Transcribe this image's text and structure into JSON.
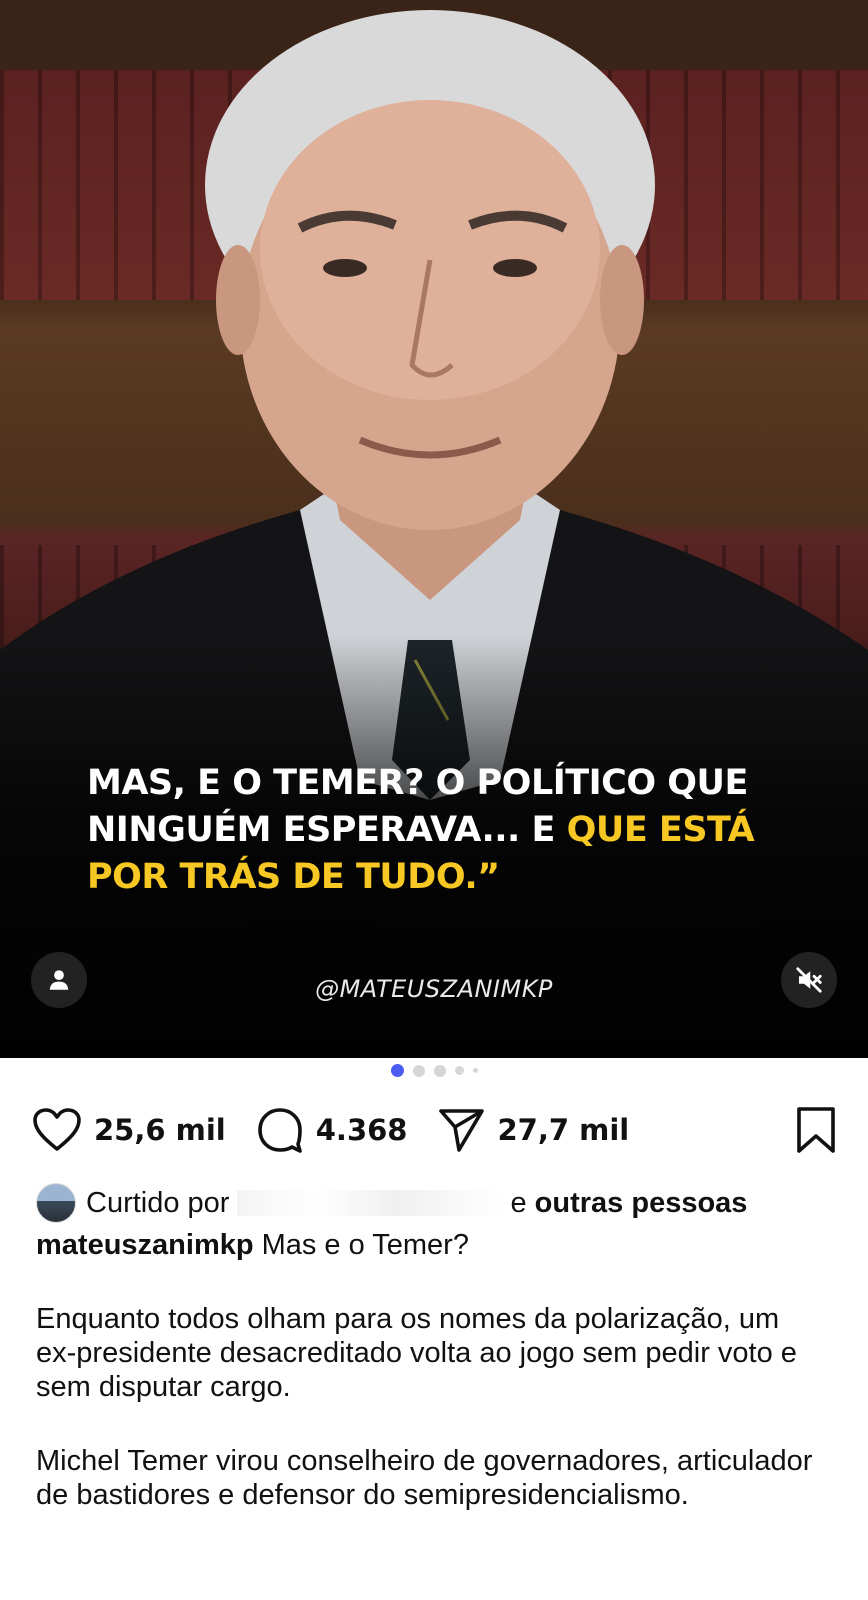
{
  "post": {
    "headline_white": "MAS, E O TEMER? O POLÍTICO QUE NINGUÉM ESPERAVA... E ",
    "headline_highlight": "QUE ESTÁ POR TRÁS DE TUDO.”",
    "handle": "@MATEUSZANIMKP",
    "highlight_color": "#f7c723",
    "user_icon": "person-icon",
    "mute_icon": "speaker-muted-icon"
  },
  "pager": {
    "total": 5,
    "active_index": 0,
    "active_color": "#4a5cf2"
  },
  "actions": {
    "likes": "25,6 mil",
    "comments": "4.368",
    "shares": "27,7 mil",
    "icons": [
      "heart-icon",
      "comment-icon",
      "send-icon",
      "bookmark-icon"
    ]
  },
  "liked_by": {
    "prefix": "Curtido por",
    "suffix": "e ",
    "others": "outras pessoas"
  },
  "caption": {
    "username": "mateuszanimkp",
    "first_line": "Mas e o Temer?",
    "paragraph1": "Enquanto todos olham para os nomes da polarização, um ex-presidente desacreditado volta ao jogo sem pedir voto e sem disputar cargo.",
    "paragraph2": "Michel Temer virou conselheiro de governadores, articulador de bastidores e defensor do semipresidencialismo."
  }
}
